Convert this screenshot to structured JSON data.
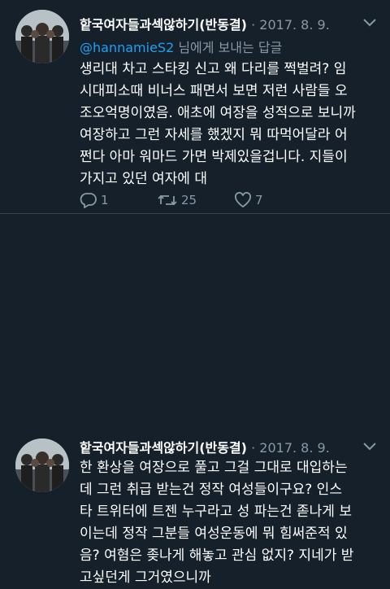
{
  "tweets": [
    {
      "name": "핱국여자들과섹않하기(반동결)",
      "separator": "·",
      "date": "2017. 8. 9.",
      "reply_prefix": "",
      "reply_handle": "@hannamieS2",
      "reply_suffix": " 님에게 보내는 답글",
      "lines": [
        "생리대 차고 스타킹 신고 왜 다리를 쩍벌려? 임",
        "시대피소때 비너스 패면서 보면 저런 사람들 오",
        "조오억명이였음. 애초에 여장을 성적으로 보니까",
        "여장하고 그런 자세를 했겠지 뭐 따먹어달라 어",
        "쩐다 아마 워마드 가면 박제있을겁니다. 지들이",
        "가지고 있던 여자에 대"
      ],
      "actions": {
        "reply_count": "1",
        "retweet_count": "25",
        "like_count": "7"
      }
    },
    {
      "name": "핱국여자들과섹않하기(반동결)",
      "separator": "·",
      "date": "2017. 8. 9.",
      "lines": [
        "한 환상을 여장으로 풀고 그걸 그대로 대입하는",
        "데 그런 취급 받는건 정작 여성들이구요?  인스",
        "타 트위터에 트젠 누구라고 성 파는건 졷나게 보",
        "이는데 정작 그분들 여성운동에 뭐 힘써준적 있",
        "음? 여혐은 좆나게 해놓고 관심 없지? 지네가 받",
        "고싶던게 그거였으니까"
      ]
    }
  ],
  "colors": {
    "background": "#15202b",
    "text": "#ffffff",
    "muted": "#8899a6",
    "link": "#1da1f2",
    "divider": "#38444d"
  },
  "icons": [
    "reply-icon",
    "retweet-icon",
    "like-icon",
    "chevron-down-icon",
    "avatar"
  ]
}
